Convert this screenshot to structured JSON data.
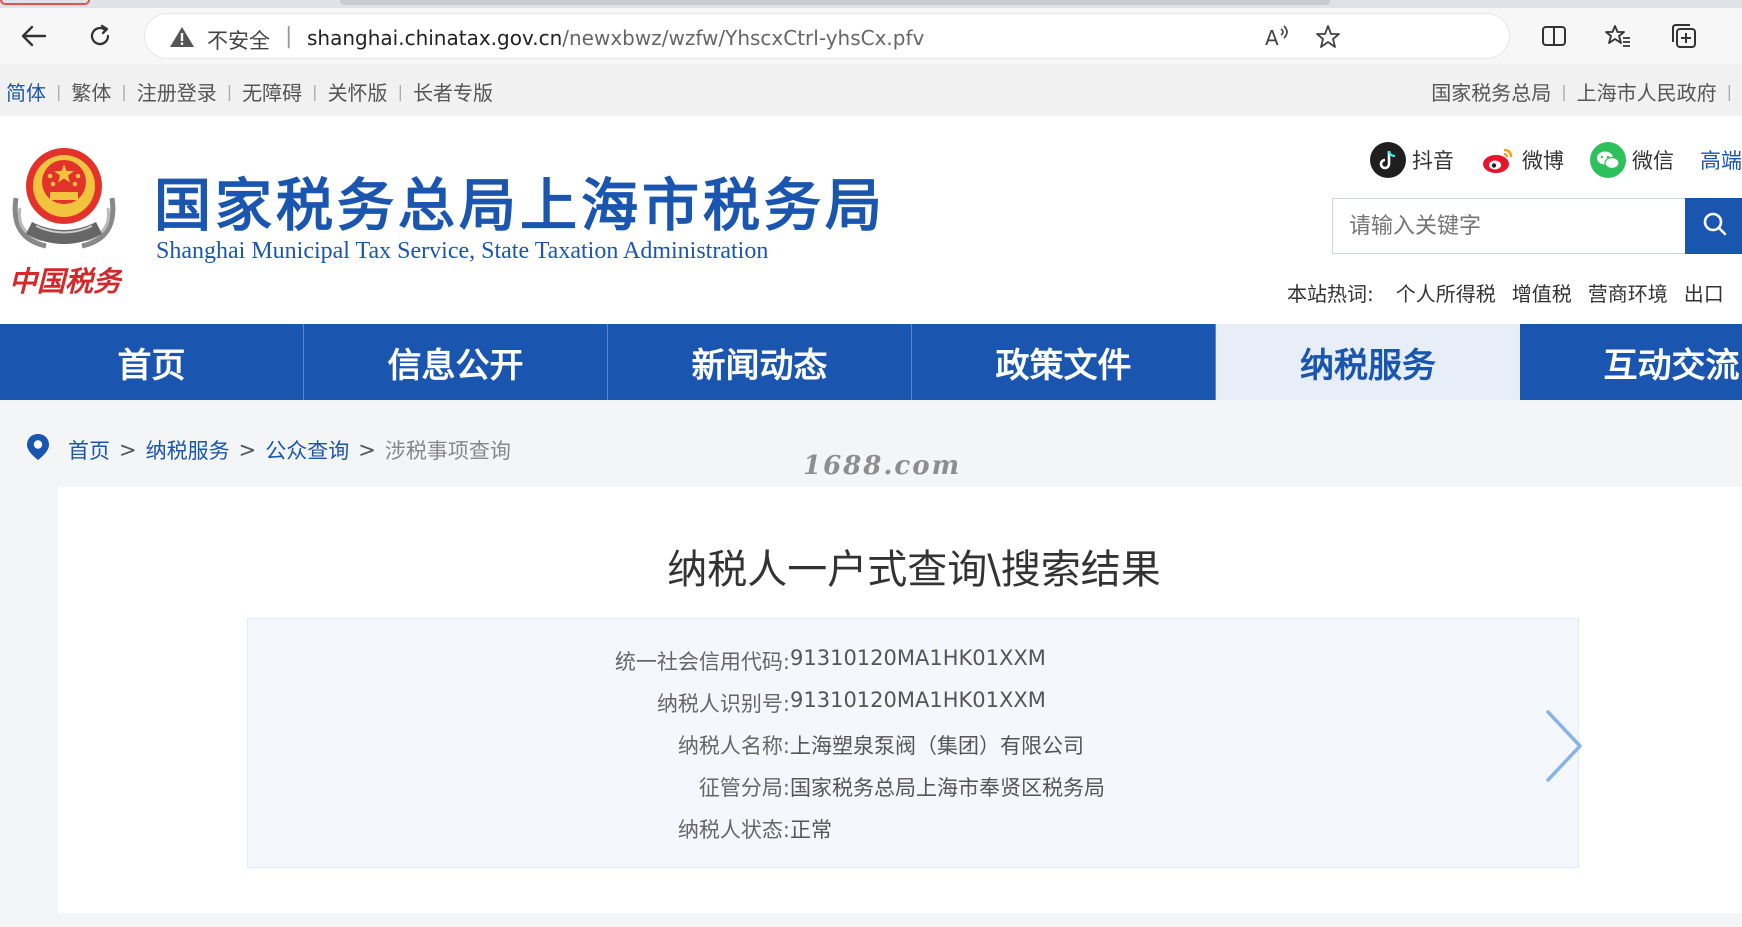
{
  "browser": {
    "security_label": "不安全",
    "url_host": "shanghai.chinatax.gov.cn",
    "url_path": "/newxbwz/wzfw/YhscxCtrl-yhsCx.pfv"
  },
  "utility": {
    "left_links": [
      "简体",
      "繁体",
      "注册登录",
      "无障碍",
      "关怀版",
      "长者专版"
    ],
    "right_links": [
      "国家税务总局",
      "上海市人民政府"
    ]
  },
  "header": {
    "title_cn": "国家税务总局上海市税务局",
    "title_en": "Shanghai Municipal Tax Service, State Taxation Administration",
    "logo_caption": "中国税务",
    "social": [
      "抖音",
      "微博",
      "微信",
      "高端"
    ],
    "search_placeholder": "请输入关键字",
    "hot_label": "本站热词:",
    "hot_words": [
      "个人所得税",
      "增值税",
      "营商环境",
      "出口"
    ]
  },
  "nav": {
    "items": [
      "首页",
      "信息公开",
      "新闻动态",
      "政策文件",
      "纳税服务",
      "互动交流"
    ],
    "active": "纳税服务"
  },
  "breadcrumb": {
    "items": [
      "首页",
      "纳税服务",
      "公众查询"
    ],
    "current": "涉税事项查询",
    "separator": ">"
  },
  "watermark": "1688.com",
  "result": {
    "title": "纳税人一户式查询\\搜索结果",
    "fields": [
      {
        "label": "统一社会信用代码:",
        "value": "91310120MA1HK01XXM"
      },
      {
        "label": "纳税人识别号:",
        "value": "91310120MA1HK01XXM"
      },
      {
        "label": "纳税人名称:",
        "value": "上海塑泉泵阀（集团）有限公司"
      },
      {
        "label": "征管分局:",
        "value": "国家税务总局上海市奉贤区税务局"
      },
      {
        "label": "纳税人状态:",
        "value": "正常"
      }
    ]
  },
  "colors": {
    "brand_blue": "#1a56b0",
    "nav_active_bg": "#e7eef8"
  }
}
